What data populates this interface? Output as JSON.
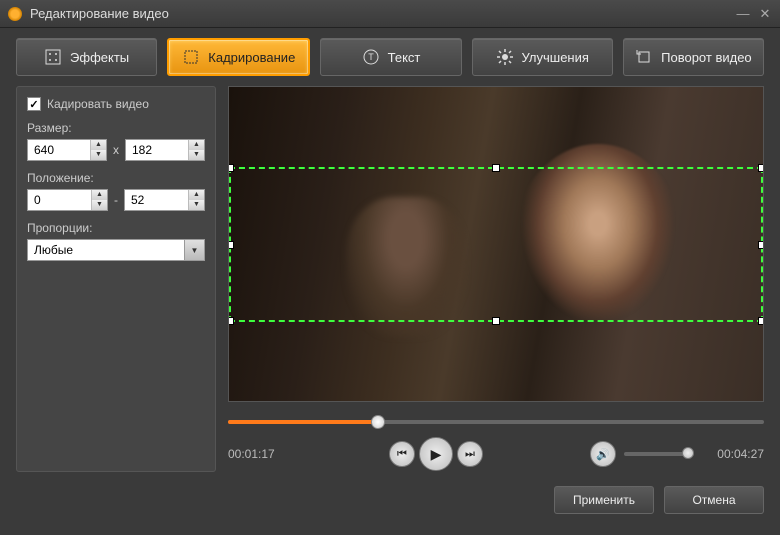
{
  "title": "Редактирование видео",
  "tabs": {
    "effects": "Эффекты",
    "crop": "Кадрирование",
    "text": "Текст",
    "improve": "Улучшения",
    "rotate": "Поворот видео"
  },
  "panel": {
    "crop_checkbox": "Кадировать видео",
    "size_label": "Размер:",
    "size_w": "640",
    "size_h": "182",
    "size_sep": "x",
    "pos_label": "Положение:",
    "pos_x": "0",
    "pos_y": "52",
    "pos_sep": "-",
    "ratio_label": "Пропорции:",
    "ratio_value": "Любые"
  },
  "player": {
    "current": "00:01:17",
    "total": "00:04:27"
  },
  "footer": {
    "apply": "Применить",
    "cancel": "Отмена"
  }
}
